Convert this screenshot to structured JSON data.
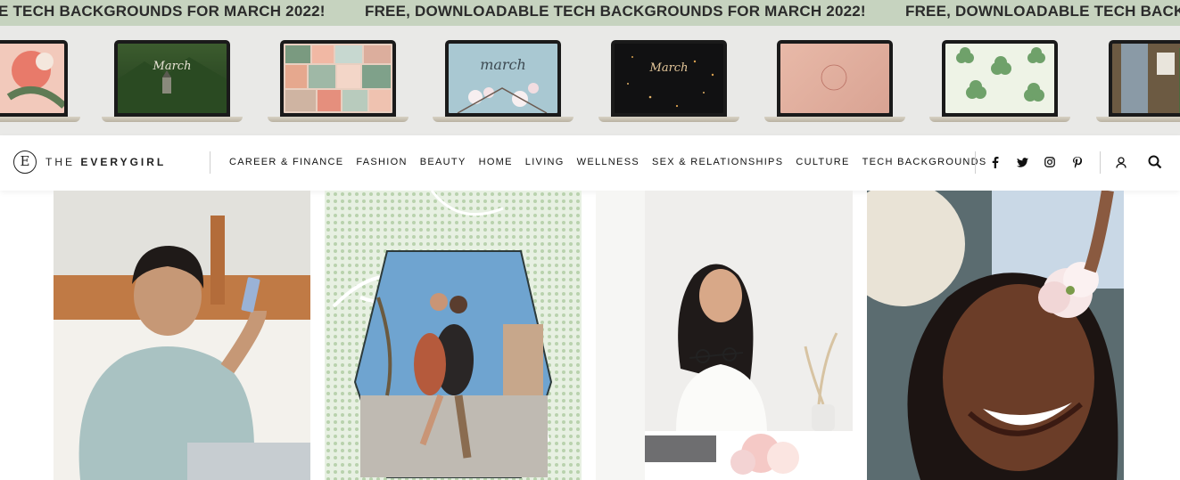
{
  "banner": {
    "ticker_text": "FREE, DOWNLOADABLE TECH BACKGROUNDS FOR MARCH 2022!",
    "ticker_prefix": "E TECH BACKGROUNDS FOR MARCH 2022!",
    "ticker_suffix": "FREE, DOWNLOADABLE TECH BACKG",
    "laptops": [
      {
        "wallpaper": "abstract-pink",
        "word": ""
      },
      {
        "wallpaper": "castle-forest",
        "word": "March"
      },
      {
        "wallpaper": "photo-collage",
        "word": ""
      },
      {
        "wallpaper": "cherry-blossom",
        "word": "march"
      },
      {
        "wallpaper": "night-sparkle",
        "word": "March"
      },
      {
        "wallpaper": "pink-texture",
        "word": ""
      },
      {
        "wallpaper": "shamrocks",
        "word": ""
      },
      {
        "wallpaper": "street-building",
        "word": ""
      }
    ]
  },
  "header": {
    "logo_mark": "E",
    "logo_the": "THE ",
    "logo_brand": "EVERYGIRL",
    "nav": [
      "CAREER & FINANCE",
      "FASHION",
      "BEAUTY",
      "HOME",
      "LIVING",
      "WELLNESS",
      "SEX & RELATIONSHIPS",
      "CULTURE",
      "TECH BACKGROUNDS"
    ],
    "social": {
      "facebook": "f",
      "twitter": "twitter-icon",
      "instagram": "instagram-icon",
      "pinterest": "p"
    },
    "account_icon": "user-icon",
    "search_icon": "search-icon"
  },
  "tiles": [
    {
      "image": "woman-in-bed-sweater"
    },
    {
      "image": "couple-hexagon-dots"
    },
    {
      "image": "woman-with-glasses-desk"
    },
    {
      "image": "smiling-woman-flower"
    }
  ],
  "colors": {
    "ticker_bg": "#c6d3bf",
    "banner_bg": "#e9e9e7",
    "text": "#111111"
  }
}
